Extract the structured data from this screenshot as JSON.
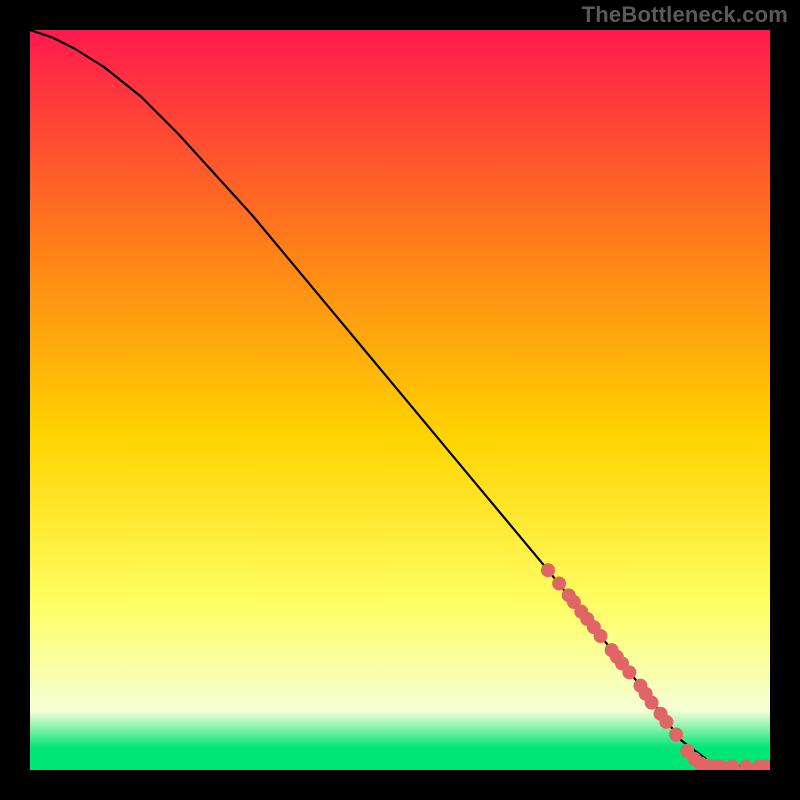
{
  "attribution": "TheBottleneck.com",
  "colors": {
    "background": "#000000",
    "gradient_top": "#ff1a4d",
    "gradient_upper_mid": "#ff7a1a",
    "gradient_mid": "#ffd400",
    "gradient_lower_mid": "#ffff66",
    "gradient_pale": "#f5ffd6",
    "gradient_green": "#00e676",
    "curve": "#000000",
    "marker_fill": "#e06666",
    "marker_stroke": "#c44d4d"
  },
  "chart_data": {
    "type": "line",
    "title": "",
    "xlabel": "",
    "ylabel": "",
    "xlim": [
      0,
      100
    ],
    "ylim": [
      0,
      100
    ],
    "series": [
      {
        "name": "bottleneck-curve",
        "x": [
          0,
          3,
          6,
          10,
          15,
          20,
          30,
          40,
          50,
          60,
          70,
          78,
          82,
          85,
          88,
          92,
          96,
          100
        ],
        "y": [
          100,
          99,
          97.5,
          95,
          91,
          86,
          75,
          63,
          51,
          39,
          27,
          17,
          12,
          8,
          4,
          1,
          0.5,
          0.5
        ]
      }
    ],
    "markers": [
      {
        "x": 70.0,
        "y": 27.0
      },
      {
        "x": 71.5,
        "y": 25.2
      },
      {
        "x": 72.8,
        "y": 23.6
      },
      {
        "x": 73.5,
        "y": 22.7
      },
      {
        "x": 74.5,
        "y": 21.4
      },
      {
        "x": 75.3,
        "y": 20.4
      },
      {
        "x": 76.2,
        "y": 19.3
      },
      {
        "x": 77.1,
        "y": 18.1
      },
      {
        "x": 78.6,
        "y": 16.2
      },
      {
        "x": 79.3,
        "y": 15.3
      },
      {
        "x": 80.0,
        "y": 14.4
      },
      {
        "x": 81.0,
        "y": 13.2
      },
      {
        "x": 82.5,
        "y": 11.4
      },
      {
        "x": 83.2,
        "y": 10.3
      },
      {
        "x": 84.0,
        "y": 9.1
      },
      {
        "x": 85.2,
        "y": 7.6
      },
      {
        "x": 86.0,
        "y": 6.5
      },
      {
        "x": 87.3,
        "y": 4.8
      },
      {
        "x": 88.8,
        "y": 2.6
      },
      {
        "x": 89.8,
        "y": 1.5
      },
      {
        "x": 90.6,
        "y": 0.9
      },
      {
        "x": 91.5,
        "y": 0.6
      },
      {
        "x": 92.4,
        "y": 0.5
      },
      {
        "x": 93.3,
        "y": 0.5
      },
      {
        "x": 94.9,
        "y": 0.5
      },
      {
        "x": 96.8,
        "y": 0.5
      },
      {
        "x": 98.5,
        "y": 0.5
      },
      {
        "x": 99.3,
        "y": 0.5
      }
    ]
  }
}
